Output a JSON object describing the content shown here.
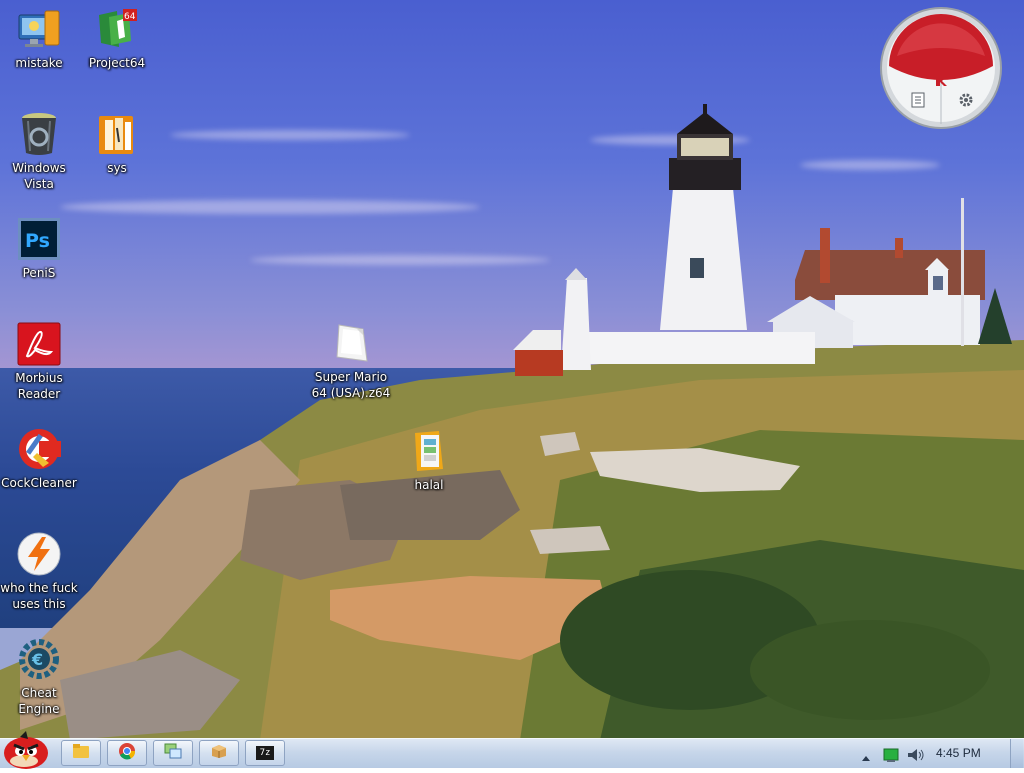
{
  "desktop": {
    "icons": [
      {
        "label": "mistake",
        "icon": "monitor-user-icon"
      },
      {
        "label": "Project64",
        "icon": "project64-icon"
      },
      {
        "label": "Windows Vista",
        "icon": "recycle-bin-icon"
      },
      {
        "label": "sys",
        "icon": "folder-icon"
      },
      {
        "label": "PeniS",
        "icon": "photoshop-icon"
      },
      {
        "label": "Morbius Reader",
        "icon": "pdf-reader-icon"
      },
      {
        "label": "CockCleaner",
        "icon": "ccleaner-icon"
      },
      {
        "label": "who the fuck uses this",
        "icon": "lightning-icon"
      },
      {
        "label": "Cheat Engine",
        "icon": "cheat-engine-icon"
      },
      {
        "label": "Super Mario 64 (USA).z64",
        "icon": "rom-file-icon"
      },
      {
        "label": "halal",
        "icon": "image-file-icon"
      }
    ],
    "gadget": {
      "name": "kaspersky-gadget",
      "accent": "#c81e28"
    }
  },
  "taskbar": {
    "start_icon": "angry-bird-start-icon",
    "pinned": [
      {
        "icon": "explorer-folder-icon"
      },
      {
        "icon": "chrome-icon"
      },
      {
        "icon": "window-switch-icon"
      },
      {
        "icon": "package-icon"
      },
      {
        "icon": "7zip-icon",
        "text": "7z"
      }
    ],
    "tray": {
      "clock": "4:45 PM",
      "icons": [
        "show-hidden-icon",
        "network-icon",
        "volume-icon"
      ]
    }
  },
  "colors": {
    "taskbar": "#c7d6ea",
    "sky_top": "#4a5fd0",
    "sea": "#2c4a96"
  }
}
